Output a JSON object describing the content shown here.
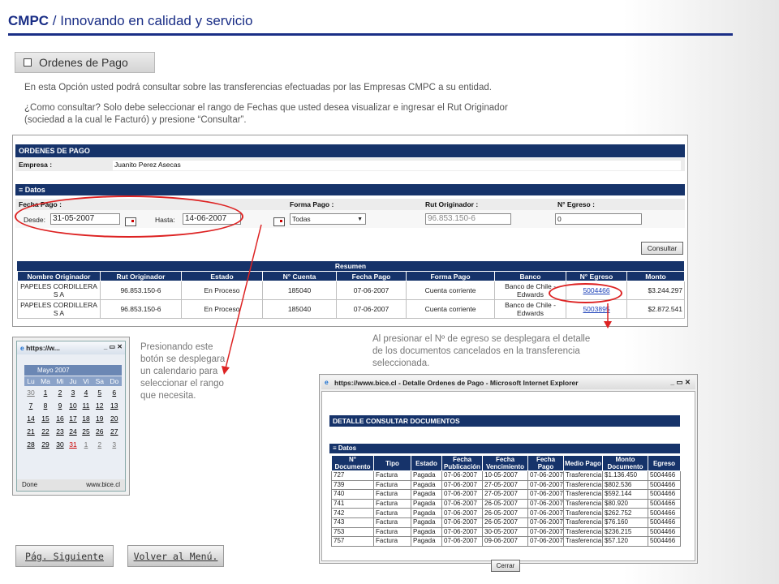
{
  "header": {
    "brand": "CMPC",
    "separator": " / ",
    "subtitle": "Innovando en calidad y servicio"
  },
  "section_button": {
    "label": "Ordenes de Pago"
  },
  "intro": {
    "line1": "En esta Opción usted podrá consultar sobre  las transferencias efectuadas por las Empresas CMPC a su entidad.",
    "line2": "¿Como consultar? Solo debe seleccionar el rango de Fechas que usted desea visualizar  e ingresar el Rut Originador",
    "line3": "(sociedad a la cual le Facturó) y presione “Consultar”."
  },
  "form": {
    "header": "ORDENES DE PAGO",
    "empresa_label": "Empresa :",
    "empresa_value": "Juanito Perez Asecas",
    "datos_label": "Datos",
    "fecha_pago_label": "Fecha Pago :",
    "forma_pago_label": "Forma Pago :",
    "rut_originador_label": "Rut Originador :",
    "n_egreso_label": "N° Egreso :",
    "desde_label": "Desde:",
    "desde_value": "31-05-2007",
    "hasta_label": "Hasta:",
    "hasta_value": "14-06-2007",
    "forma_pago_value": "Todas",
    "rut_value": "96.853.150-6",
    "egreso_value": "0",
    "consultar_button": "Consultar",
    "resumen_label": "Resumen",
    "columns": [
      "Nombre Originador",
      "Rut Originador",
      "Estado",
      "N° Cuenta",
      "Fecha Pago",
      "Forma Pago",
      "Banco",
      "N° Egreso",
      "Monto"
    ],
    "rows": [
      {
        "nombre": "PAPELES CORDILLERA S A",
        "rut": "96.853.150-6",
        "estado": "En Proceso",
        "cuenta": "185040",
        "fecha": "07-06-2007",
        "forma": "Cuenta corriente",
        "banco": "Banco de Chile - Edwards",
        "egreso": "5004466",
        "monto": "$3.244.297"
      },
      {
        "nombre": "PAPELES CORDILLERA S A",
        "rut": "96.853.150-6",
        "estado": "En Proceso",
        "cuenta": "185040",
        "fecha": "07-06-2007",
        "forma": "Cuenta corriente",
        "banco": "Banco de Chile - Edwards",
        "egreso": "5003895",
        "monto": "$2.872.541"
      }
    ]
  },
  "calendar": {
    "window_title": "https://w...",
    "month": "Mayo 2007",
    "weekdays": [
      "Lu",
      "Ma",
      "Mi",
      "Ju",
      "Vi",
      "Sa",
      "Do"
    ],
    "weeks": [
      [
        "30",
        "1",
        "2",
        "3",
        "4",
        "5",
        "6"
      ],
      [
        "7",
        "8",
        "9",
        "10",
        "11",
        "12",
        "13"
      ],
      [
        "14",
        "15",
        "16",
        "17",
        "18",
        "19",
        "20"
      ],
      [
        "21",
        "22",
        "23",
        "24",
        "25",
        "26",
        "27"
      ],
      [
        "28",
        "29",
        "30",
        "31",
        "1",
        "2",
        "3"
      ]
    ],
    "status_left": "Done",
    "status_right": "www.bice.cl"
  },
  "notes": {
    "calendar_note": [
      "Presionando este",
      "botón se desplegara",
      "un calendario para",
      "seleccionar el rango",
      "que necesita."
    ],
    "egreso_note": [
      "Al presionar el Nº de egreso se desplegara el detalle",
      "de los documentos cancelados en la transferencia",
      "seleccionada."
    ]
  },
  "detail_popup": {
    "window_title": "https://www.bice.cl - Detalle Ordenes de Pago - Microsoft Internet Explorer",
    "header": "DETALLE CONSULTAR DOCUMENTOS",
    "datos_label": "Datos",
    "columns": [
      "N° Documento",
      "Tipo",
      "Estado",
      "Fecha Publicación",
      "Fecha Vencimiento",
      "Fecha Pago",
      "Medio Pago",
      "Monto Documento",
      "Egreso"
    ],
    "rows": [
      [
        "727",
        "Factura",
        "Pagada",
        "07-06-2007",
        "10-05-2007",
        "07-06-2007",
        "Trasferencia",
        "$1.136.450",
        "5004466"
      ],
      [
        "739",
        "Factura",
        "Pagada",
        "07-06-2007",
        "27-05-2007",
        "07-06-2007",
        "Trasferencia",
        "$802.536",
        "5004466"
      ],
      [
        "740",
        "Factura",
        "Pagada",
        "07-06-2007",
        "27-05-2007",
        "07-06-2007",
        "Trasferencia",
        "$592.144",
        "5004466"
      ],
      [
        "741",
        "Factura",
        "Pagada",
        "07-06-2007",
        "26-05-2007",
        "07-06-2007",
        "Trasferencia",
        "$80.920",
        "5004466"
      ],
      [
        "742",
        "Factura",
        "Pagada",
        "07-06-2007",
        "26-05-2007",
        "07-06-2007",
        "Trasferencia",
        "$262.752",
        "5004466"
      ],
      [
        "743",
        "Factura",
        "Pagada",
        "07-06-2007",
        "26-05-2007",
        "07-06-2007",
        "Trasferencia",
        "$76.160",
        "5004466"
      ],
      [
        "753",
        "Factura",
        "Pagada",
        "07-06-2007",
        "30-05-2007",
        "07-06-2007",
        "Trasferencia",
        "$236.215",
        "5004466"
      ],
      [
        "757",
        "Factura",
        "Pagada",
        "07-06-2007",
        "09-06-2007",
        "07-06-2007",
        "Trasferencia",
        "$57.120",
        "5004466"
      ]
    ],
    "cerrar_button": "Cerrar"
  },
  "nav": {
    "next_label": "Pág. Siguiente",
    "back_label": "Volver al Menú."
  },
  "colors": {
    "brand_blue": "#1a2e86",
    "table_header": "#16336a",
    "highlight_red": "#d22222"
  }
}
